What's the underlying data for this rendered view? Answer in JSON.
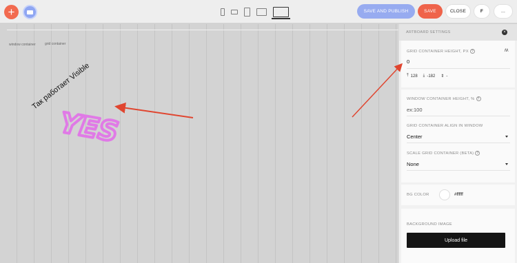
{
  "toolbar": {
    "add_glyph": "+",
    "publish_label": "SAVE AND PUBLISH",
    "save_label": "SAVE",
    "close_label": "CLOSE",
    "f_label": "f",
    "more_label": "..."
  },
  "devices": [
    "phone-icon",
    "phone-landscape-icon",
    "tablet-icon",
    "tablet-landscape-icon",
    "desktop-icon"
  ],
  "canvas": {
    "window_label": "window container",
    "grid_label": "grid container",
    "rotated_text": "Так работает Visible",
    "yes_text": "YES"
  },
  "panel": {
    "title": "ARTBOARD SETTINGS",
    "close_glyph": "×",
    "grid_height_label": "GRID CONTAINER HEIGHT, PX",
    "grid_height_value": "0",
    "aa_glyph": "/\\/\\",
    "metric_top": "128",
    "metric_bottom": "-182",
    "metric_mid": "-",
    "window_height_label": "WINDOW CONTAINER HEIGHT, %",
    "window_height_placeholder": "ex:100",
    "align_label": "GRID CONTAINER ALIGN IN WINDOW",
    "align_value": "Center",
    "scale_label": "SCALE GRID CONTAINER (BETA)",
    "scale_value": "None",
    "bg_color_label": "BG COLOR",
    "bg_color_value": "#ffffff",
    "bg_image_label": "BACKGROUND IMAGE",
    "upload_label": "Upload file",
    "help_glyph": "?"
  },
  "colors": {
    "accent": "#ef634a",
    "publish": "#97abf0",
    "arrow": "#e0452f",
    "yes": "#e57ae8"
  }
}
